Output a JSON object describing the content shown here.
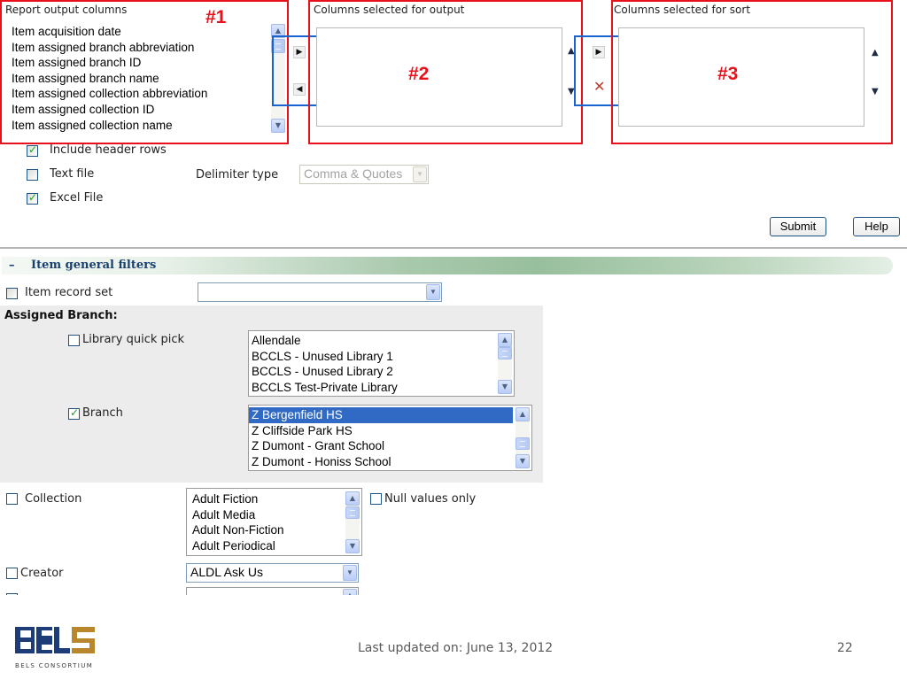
{
  "report_output": {
    "title": "Report output columns",
    "items": [
      "Item acquisition date",
      "Item assigned branch abbreviation",
      "Item assigned branch ID",
      "Item assigned branch name",
      "Item assigned collection abbreviation",
      "Item assigned collection ID",
      "Item assigned collection name"
    ],
    "callout": "#1"
  },
  "selected_output": {
    "title": "Columns selected for output",
    "callout": "#2"
  },
  "selected_sort": {
    "title": "Columns selected for sort",
    "callout": "#3"
  },
  "options": {
    "include_header": {
      "label": "Include header rows",
      "checked": true
    },
    "text_file": {
      "label": "Text file",
      "checked": false
    },
    "delimiter_label": "Delimiter type",
    "delimiter_value": "Comma & Quotes",
    "excel_file": {
      "label": "Excel File",
      "checked": true
    }
  },
  "buttons": {
    "submit": "Submit",
    "help": "Help"
  },
  "filters": {
    "collapse_symbol": "–",
    "title": "Item general filters",
    "item_record_set_label": "Item record set",
    "assigned_branch_label": "Assigned Branch:",
    "library_quick_pick": {
      "label": "Library quick pick",
      "checked": false,
      "options": [
        "Allendale",
        "BCCLS - Unused Library 1",
        "BCCLS - Unused Library 2",
        "BCCLS Test-Private Library"
      ]
    },
    "branch": {
      "label": "Branch",
      "checked": true,
      "options": [
        "Z Bergenfield HS",
        "Z Cliffside Park HS",
        "Z Dumont - Grant School",
        "Z Dumont - Honiss School"
      ],
      "selected_index": 0
    },
    "collection": {
      "label": "Collection",
      "checked": false,
      "options": [
        "Adult Fiction",
        "Adult Media",
        "Adult Non-Fiction",
        "Adult Periodical"
      ]
    },
    "null_values_only": {
      "label": "Null values only",
      "checked": false
    },
    "creator": {
      "label": "Creator",
      "checked": false,
      "value": "ALDL Ask Us"
    }
  },
  "footer": {
    "logo_text": "BELS",
    "logo_subtitle": "BELS CONSORTIUM",
    "updated": "Last updated on: June 13, 2012",
    "page_number": "22"
  },
  "colors": {
    "callout_red": "#e8101a",
    "highlight_blue": "#1a64d2",
    "selection": "#316ac5",
    "section_title": "#1a4070"
  },
  "icons": [
    "scroll-up-icon",
    "scroll-down-icon",
    "move-right-icon",
    "move-left-icon",
    "move-up-icon",
    "move-down-icon",
    "remove-x-icon",
    "dropdown-arrow-icon",
    "checkbox-icon",
    "collapse-icon"
  ]
}
